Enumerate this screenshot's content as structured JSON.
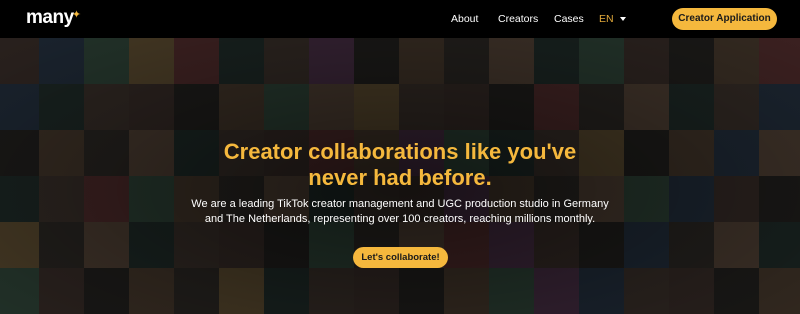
{
  "header": {
    "logo_text": "many",
    "nav": {
      "about": "About",
      "creators": "Creators",
      "cases": "Cases"
    },
    "language": "EN",
    "cta_label": "Creator Application"
  },
  "hero": {
    "title_line1": "Creator collaborations like you've",
    "title_line2": "never had before.",
    "subtitle_line1": "We are a leading TikTok creator management and UGC production studio in Germany",
    "subtitle_line2": "and The Netherlands, representing over 100 creators, reaching millions monthly.",
    "cta_label": "Let's collaborate!"
  },
  "colors": {
    "accent": "#f5b83d",
    "background": "#000000",
    "text": "#ffffff"
  },
  "icons": {
    "language_caret": "caret-down-icon",
    "logo_mark": "spark-icon"
  }
}
